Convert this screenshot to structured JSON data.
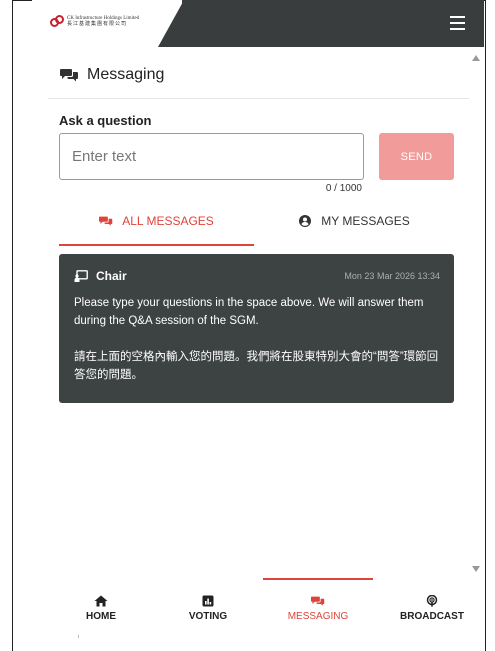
{
  "header": {
    "logo_en": "CK Infrastructure Holdings Limited",
    "logo_zh": "長江基建集團有限公司",
    "menu_icon": "hamburger-icon",
    "bg_color": "#3a3d3d"
  },
  "messaging": {
    "title": "Messaging",
    "title_icon": "chat-bubbles-icon",
    "ask_label": "Ask a question",
    "input": {
      "placeholder": "Enter text",
      "value": ""
    },
    "send_label": "SEND",
    "send_color": "#f19c9a",
    "counter": "0 / 1000"
  },
  "tabs": [
    {
      "label": "ALL MESSAGES",
      "icon": "chat-bubbles-icon",
      "active": true
    },
    {
      "label": "MY MESSAGES",
      "icon": "user-circle-icon",
      "active": false
    }
  ],
  "accent_color": "#e0433a",
  "message": {
    "from": "Chair",
    "icon": "presenter-icon",
    "time": "Mon 23 Mar 2026 13:34",
    "body_en": "Please type your questions in the space above.  We will answer them during the Q&A session of the SGM.",
    "body_zh": "請在上面的空格內輸入您的問題。我們將在股東特別大會的“問答”環節回答您的問題。",
    "bg_color": "#3d4242"
  },
  "nav": [
    {
      "label": "HOME",
      "icon": "home-icon",
      "active": false
    },
    {
      "label": "VOTING",
      "icon": "bar-chart-icon",
      "active": false
    },
    {
      "label": "MESSAGING",
      "icon": "chat-bubbles-icon",
      "active": true
    },
    {
      "label": "BROADCAST",
      "icon": "podcast-icon",
      "active": false
    }
  ]
}
